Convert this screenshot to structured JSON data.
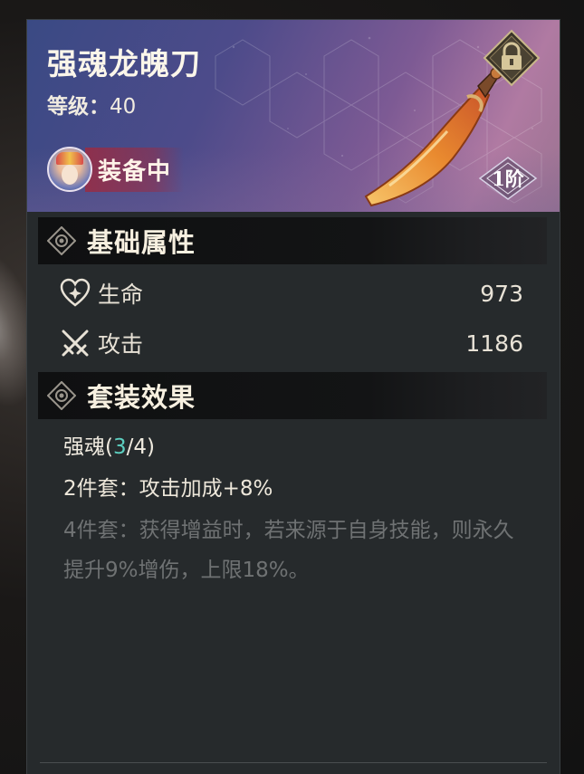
{
  "item": {
    "name": "强魂龙魄刀",
    "level_label": "等级：",
    "level_value": "40",
    "equipped_label": "装备中",
    "rank_label": "1阶"
  },
  "icons": {
    "lock": "lock-icon",
    "weapon": "sword-icon",
    "avatar": "character-avatar",
    "section": "diamond-eye-icon",
    "hp": "heart-icon",
    "atk": "crossed-swords-icon"
  },
  "sections": {
    "base_attrs_title": "基础属性",
    "set_effect_title": "套装效果"
  },
  "stats": [
    {
      "label": "生命",
      "value": "973"
    },
    {
      "label": "攻击",
      "value": "1186"
    }
  ],
  "set_effect": {
    "name_prefix": "强魂(",
    "count_current": "3",
    "count_suffix": "/4)",
    "bonus_2": "2件套：攻击加成+8%",
    "bonus_4": "4件套：获得增益时，若来源于自身技能，则永久提升9%增伤，上限18%。"
  },
  "colors": {
    "panel_bg": "#262a2c",
    "accent_count": "#5ccfc0",
    "inactive_text": "#6f7273",
    "equipped_bg": "#962d46"
  }
}
